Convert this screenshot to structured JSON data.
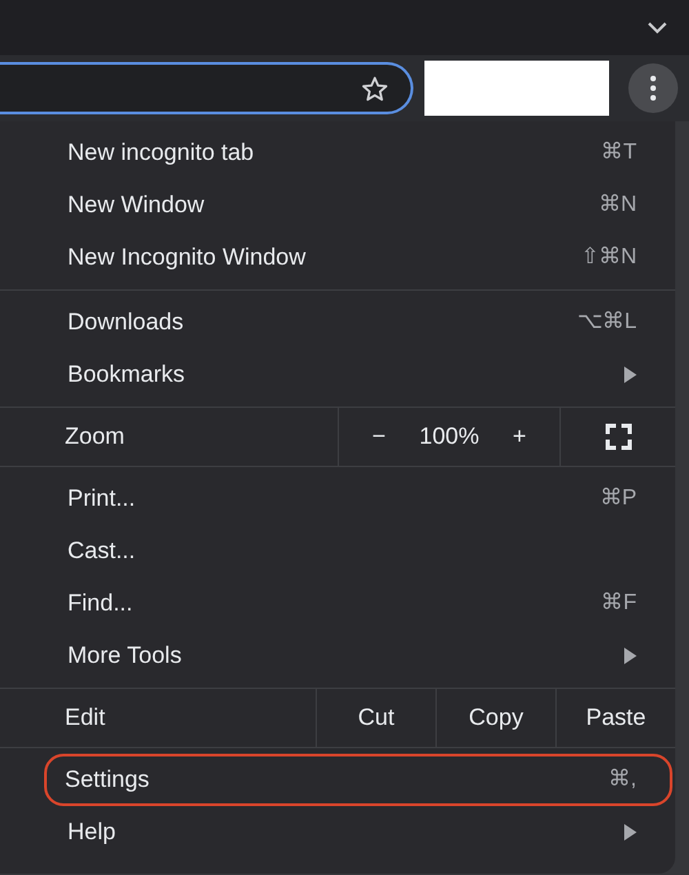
{
  "address_bar": {
    "focused": true
  },
  "menu": {
    "groups": [
      [
        {
          "kind": "item",
          "label": "New incognito tab",
          "shortcut": "⌘T",
          "submenu": false,
          "highlighted": false
        },
        {
          "kind": "item",
          "label": "New Window",
          "shortcut": "⌘N",
          "submenu": false,
          "highlighted": false
        },
        {
          "kind": "item",
          "label": "New Incognito Window",
          "shortcut": "⇧⌘N",
          "submenu": false,
          "highlighted": false
        }
      ],
      [
        {
          "kind": "item",
          "label": "Downloads",
          "shortcut": "⌥⌘L",
          "submenu": false,
          "highlighted": false
        },
        {
          "kind": "item",
          "label": "Bookmarks",
          "submenu": true,
          "highlighted": false
        }
      ],
      [
        {
          "kind": "zoom",
          "label": "Zoom",
          "minus": "−",
          "value": "100%",
          "plus": "+"
        }
      ],
      [
        {
          "kind": "item",
          "label": "Print...",
          "shortcut": "⌘P",
          "submenu": false,
          "highlighted": false
        },
        {
          "kind": "item",
          "label": "Cast...",
          "submenu": false,
          "highlighted": false
        },
        {
          "kind": "item",
          "label": "Find...",
          "shortcut": "⌘F",
          "submenu": false,
          "highlighted": false
        },
        {
          "kind": "item",
          "label": "More Tools",
          "submenu": true,
          "highlighted": false
        }
      ],
      [
        {
          "kind": "edit",
          "label": "Edit",
          "actions": [
            "Cut",
            "Copy",
            "Paste"
          ]
        }
      ],
      [
        {
          "kind": "item",
          "label": "Settings",
          "shortcut": "⌘,",
          "submenu": false,
          "highlighted": true
        },
        {
          "kind": "item",
          "label": "Help",
          "submenu": true,
          "highlighted": false
        }
      ]
    ]
  }
}
